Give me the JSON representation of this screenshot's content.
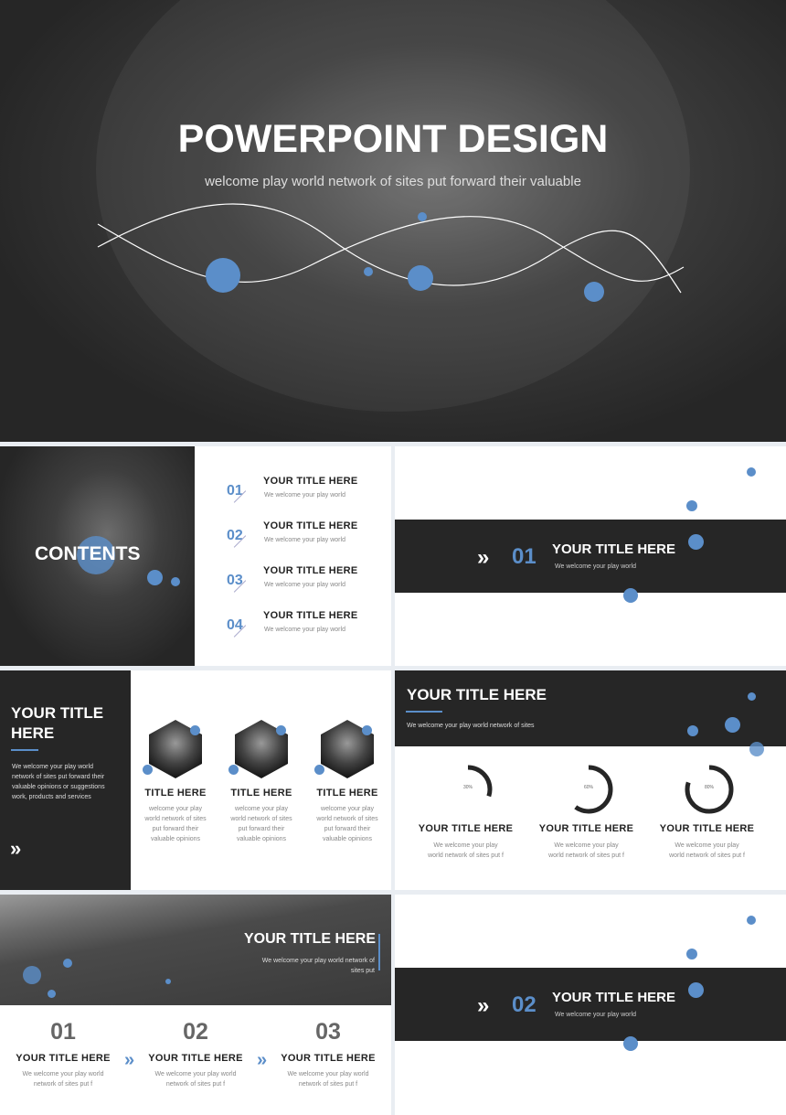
{
  "hero": {
    "title": "POWERPOINT DESIGN",
    "subtitle": "welcome play world network of sites put forward their valuable"
  },
  "contents": {
    "title": "CONTENTS",
    "items": [
      {
        "num": "01",
        "title": "YOUR TITLE HERE",
        "text": "We welcome your play world"
      },
      {
        "num": "02",
        "title": "YOUR TITLE HERE",
        "text": "We welcome your play world"
      },
      {
        "num": "03",
        "title": "YOUR TITLE HERE",
        "text": "We welcome your play world"
      },
      {
        "num": "04",
        "title": "YOUR TITLE HERE",
        "text": "We welcome your play world"
      }
    ]
  },
  "section1": {
    "arrow": "»",
    "num": "01",
    "title": "YOUR TITLE HERE",
    "text": "We welcome your play world"
  },
  "team": {
    "title": "YOUR TITLE HERE",
    "text": "We welcome your play world network of sites put forward their valuable opinions or suggestions work, products and services",
    "arrow": "»",
    "members": [
      {
        "name": "TITLE HERE",
        "text": "welcome your play world network of sites put forward their valuable opinions"
      },
      {
        "name": "TITLE HERE",
        "text": "welcome your play world network of sites put forward their valuable opinions"
      },
      {
        "name": "TITLE HERE",
        "text": "welcome your play world network of sites put forward their valuable opinions"
      }
    ]
  },
  "progress": {
    "title": "YOUR TITLE HERE",
    "text": "We welcome your play world network of sites",
    "items": [
      {
        "percent": 30,
        "label": "30%",
        "title": "YOUR TITLE HERE",
        "text": "We welcome your play world network of sites put f"
      },
      {
        "percent": 60,
        "label": "60%",
        "title": "YOUR TITLE HERE",
        "text": "We welcome your play world network of sites put f"
      },
      {
        "percent": 80,
        "label": "80%",
        "title": "YOUR TITLE HERE",
        "text": "We welcome your play world network of sites put f"
      }
    ]
  },
  "steps": {
    "title": "YOUR TITLE HERE",
    "text": "We welcome your play world network of sites put",
    "arrow": "»",
    "items": [
      {
        "num": "01",
        "title": "YOUR TITLE HERE",
        "text": "We welcome your play world network of sites put f"
      },
      {
        "num": "02",
        "title": "YOUR TITLE HERE",
        "text": "We welcome your play world network of sites put f"
      },
      {
        "num": "03",
        "title": "YOUR TITLE HERE",
        "text": "We welcome your play world network of sites put f"
      }
    ]
  },
  "section2": {
    "arrow": "»",
    "num": "02",
    "title": "YOUR TITLE HERE",
    "text": "We welcome your play world"
  },
  "colors": {
    "accent": "#5b8ec9",
    "dark": "#262626"
  }
}
